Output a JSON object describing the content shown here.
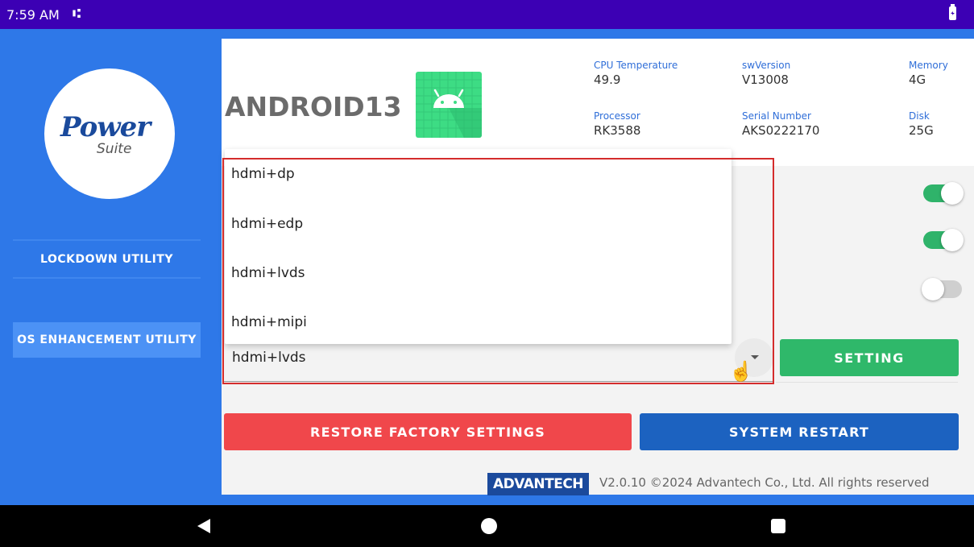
{
  "status_bar": {
    "time": "7:59 AM",
    "usb_icon": "usb-icon",
    "battery_icon": "battery-charging-icon"
  },
  "sidebar": {
    "logo": {
      "brand": "Power",
      "sub": "Suite"
    },
    "items": [
      {
        "label": "LOCKDOWN UTILITY",
        "active": false
      },
      {
        "label": "OS ENHANCEMENT UTILITY",
        "active": true
      }
    ]
  },
  "header": {
    "title": "ANDROID13",
    "info": [
      {
        "label": "CPU Temperature",
        "value": "49.9"
      },
      {
        "label": "swVersion",
        "value": "V13008"
      },
      {
        "label": "Memory",
        "value": "4G"
      },
      {
        "label": "Processor",
        "value": "RK3588"
      },
      {
        "label": "Serial Number",
        "value": "AKS0222170"
      },
      {
        "label": "Disk",
        "value": "25G"
      }
    ]
  },
  "toggles": [
    {
      "state": "on"
    },
    {
      "state": "on"
    },
    {
      "state": "off"
    }
  ],
  "display_mode": {
    "selected": "hdmi+lvds",
    "options": [
      "hdmi+dp",
      "hdmi+edp",
      "hdmi+lvds",
      "hdmi+mipi"
    ]
  },
  "buttons": {
    "setting": "SETTING",
    "restore": "RESTORE FACTORY SETTINGS",
    "restart": "SYSTEM RESTART"
  },
  "footer": {
    "brand": "ADVANTECH",
    "copyright": "V2.0.10 ©2024 Advantech Co., Ltd.  All rights reserved"
  },
  "colors": {
    "status_bar": "#3c00b4",
    "background": "#2e78e8",
    "setting_green": "#2fb86a",
    "restore_red": "#f0474b",
    "restart_blue": "#1c62c0",
    "highlight": "#d42c2c"
  }
}
